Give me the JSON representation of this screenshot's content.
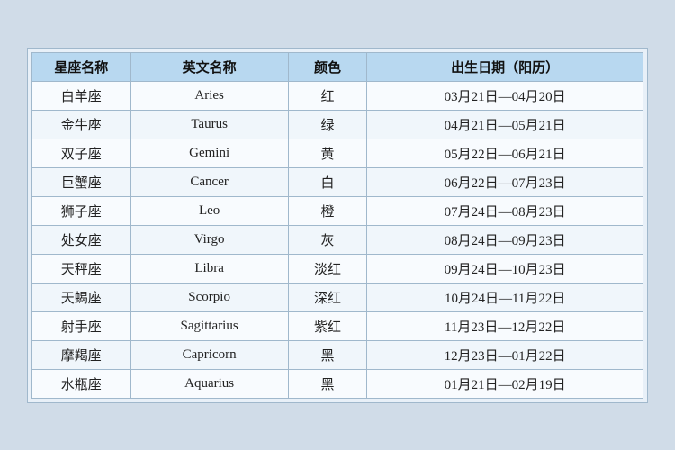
{
  "table": {
    "headers": [
      "星座名称",
      "英文名称",
      "颜色",
      "出生日期（阳历）"
    ],
    "rows": [
      {
        "cn": "白羊座",
        "en": "Aries",
        "color": "红",
        "date": "03月21日—04月20日"
      },
      {
        "cn": "金牛座",
        "en": "Taurus",
        "color": "绿",
        "date": "04月21日—05月21日"
      },
      {
        "cn": "双子座",
        "en": "Gemini",
        "color": "黄",
        "date": "05月22日—06月21日"
      },
      {
        "cn": "巨蟹座",
        "en": "Cancer",
        "color": "白",
        "date": "06月22日—07月23日"
      },
      {
        "cn": "狮子座",
        "en": "Leo",
        "color": "橙",
        "date": "07月24日—08月23日"
      },
      {
        "cn": "处女座",
        "en": "Virgo",
        "color": "灰",
        "date": "08月24日—09月23日"
      },
      {
        "cn": "天秤座",
        "en": "Libra",
        "color": "淡红",
        "date": "09月24日—10月23日"
      },
      {
        "cn": "天蝎座",
        "en": "Scorpio",
        "color": "深红",
        "date": "10月24日—11月22日"
      },
      {
        "cn": "射手座",
        "en": "Sagittarius",
        "color": "紫红",
        "date": "11月23日—12月22日"
      },
      {
        "cn": "摩羯座",
        "en": "Capricorn",
        "color": "黑",
        "date": "12月23日—01月22日"
      },
      {
        "cn": "水瓶座",
        "en": "Aquarius",
        "color": "黑",
        "date": "01月21日—02月19日"
      }
    ]
  }
}
